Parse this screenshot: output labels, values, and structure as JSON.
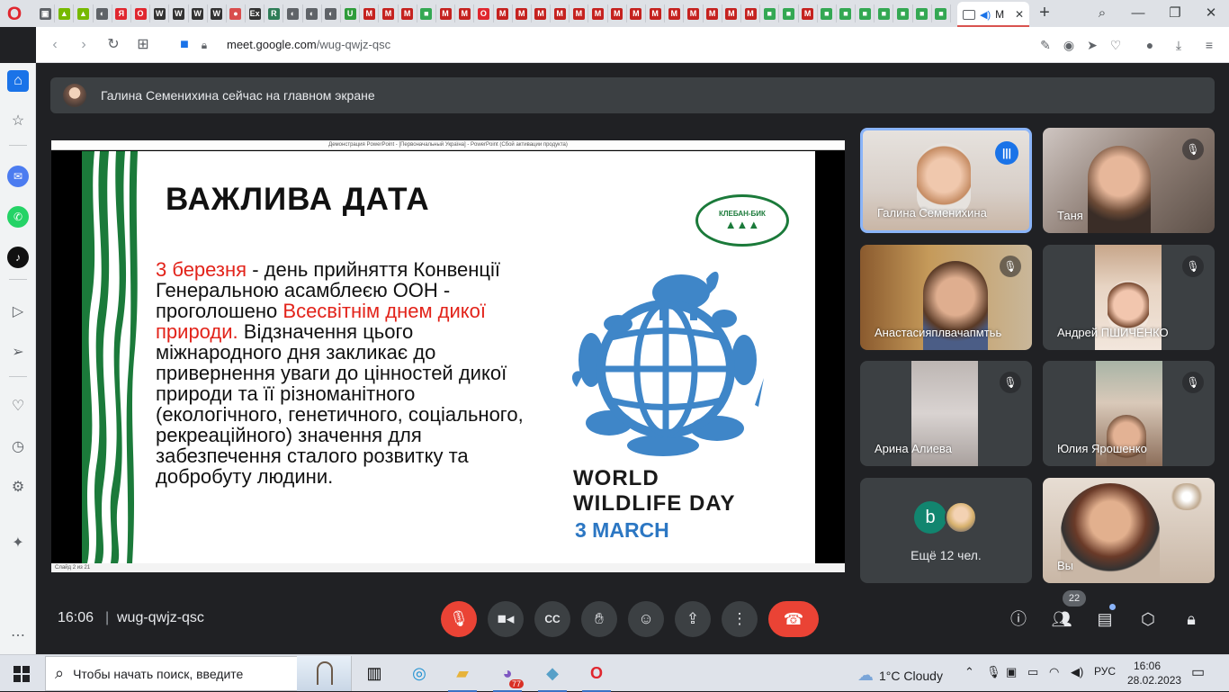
{
  "browser": {
    "active_tab_label": "M",
    "new_tab": "+",
    "favicons": [
      {
        "c": "#5f6368",
        "t": "▣"
      },
      {
        "c": "#76b900",
        "t": "▲"
      },
      {
        "c": "#76b900",
        "t": "▲"
      },
      {
        "c": "#5f6368",
        "t": "◐"
      },
      {
        "c": "#e0262e",
        "t": "Я"
      },
      {
        "c": "#e0262e",
        "t": "O"
      },
      {
        "c": "#333333",
        "t": "W"
      },
      {
        "c": "#333333",
        "t": "W"
      },
      {
        "c": "#333333",
        "t": "W"
      },
      {
        "c": "#333333",
        "t": "W"
      },
      {
        "c": "#d94d4d",
        "t": "●"
      },
      {
        "c": "#333333",
        "t": "Ex"
      },
      {
        "c": "#2e7d57",
        "t": "R"
      },
      {
        "c": "#5f6368",
        "t": "◐"
      },
      {
        "c": "#5f6368",
        "t": "◐"
      },
      {
        "c": "#5f6368",
        "t": "◐"
      },
      {
        "c": "#2e9c3a",
        "t": "U"
      },
      {
        "c": "#c5221f",
        "t": "M"
      },
      {
        "c": "#c5221f",
        "t": "M"
      },
      {
        "c": "#c5221f",
        "t": "M"
      },
      {
        "c": "#34a853",
        "t": "■"
      },
      {
        "c": "#c5221f",
        "t": "M"
      },
      {
        "c": "#c5221f",
        "t": "M"
      },
      {
        "c": "#e0262e",
        "t": "O"
      },
      {
        "c": "#c5221f",
        "t": "M"
      },
      {
        "c": "#c5221f",
        "t": "M"
      },
      {
        "c": "#c5221f",
        "t": "M"
      },
      {
        "c": "#c5221f",
        "t": "M"
      },
      {
        "c": "#c5221f",
        "t": "M"
      },
      {
        "c": "#c5221f",
        "t": "M"
      },
      {
        "c": "#c5221f",
        "t": "M"
      },
      {
        "c": "#c5221f",
        "t": "M"
      },
      {
        "c": "#c5221f",
        "t": "M"
      },
      {
        "c": "#c5221f",
        "t": "M"
      },
      {
        "c": "#c5221f",
        "t": "M"
      },
      {
        "c": "#c5221f",
        "t": "M"
      },
      {
        "c": "#c5221f",
        "t": "M"
      },
      {
        "c": "#c5221f",
        "t": "M"
      },
      {
        "c": "#34a853",
        "t": "■"
      },
      {
        "c": "#34a853",
        "t": "■"
      },
      {
        "c": "#c5221f",
        "t": "M"
      },
      {
        "c": "#34a853",
        "t": "■"
      },
      {
        "c": "#34a853",
        "t": "■"
      },
      {
        "c": "#34a853",
        "t": "■"
      },
      {
        "c": "#34a853",
        "t": "■"
      },
      {
        "c": "#34a853",
        "t": "■"
      },
      {
        "c": "#34a853",
        "t": "■"
      },
      {
        "c": "#34a853",
        "t": "■"
      }
    ],
    "url_host": "meet.google.com",
    "url_path": "/wug-qwjz-qsc"
  },
  "banner": {
    "text": "Галина Семенихина сейчас на главном экране"
  },
  "presentation": {
    "titlebar": "Демонстрация PowerPoint - [Первоначальный Україна] - PowerPoint (Сбой активации продукта)",
    "statusbar": "Слайд 2 из 21",
    "slide": {
      "title": "ВАЖЛИВА ДАТА",
      "para_red1": "3 березня",
      "para_1": " - день прийняття Конвенції Генеральною асамблеєю ООН - проголошено ",
      "para_red2": "Всесвітнім днем дикої природи.",
      "para_2": " Відзначення цього міжнародного дня закликає до привернення уваги до цінностей дикої природи та її різноманітного (екологічного, генетичного, соціального, рекреаційного) значення для забезпечення сталого розвитку та добробуту людини.",
      "logo_text": "КЛЕБАН-БИК",
      "wwd_line1": "WORLD",
      "wwd_line2": "WILDLIFE DAY",
      "wwd_line3": "3 MARCH",
      "accent_red": "#e2231a",
      "accent_blue": "#3f86c8",
      "accent_green": "#1b7a3a"
    }
  },
  "participants": [
    {
      "name": "Галина Семенихина",
      "state": "speaking"
    },
    {
      "name": "Таня",
      "state": "muted"
    },
    {
      "name": "Анастасияплвачапмтьь",
      "state": "muted"
    },
    {
      "name": "Андрей ПШИЧЕНКО",
      "state": "muted"
    },
    {
      "name": "Арина Алиева",
      "state": "muted"
    },
    {
      "name": "Юлия Ярошенко",
      "state": "muted"
    },
    {
      "name": "Ещё 12 чел.",
      "state": "more",
      "avatar_letter": "b"
    },
    {
      "name": "Вы",
      "state": "self"
    }
  ],
  "controls": {
    "time": "16:06",
    "separator": "|",
    "meeting_code": "wug-qwjz-qsc",
    "participant_count": "22"
  },
  "taskbar": {
    "search_placeholder": "Чтобы начать поиск, введите",
    "opera_badge": "77",
    "weather": "1°C  Cloudy",
    "lang": "РУС",
    "time": "16:06",
    "date": "28.02.2023"
  }
}
